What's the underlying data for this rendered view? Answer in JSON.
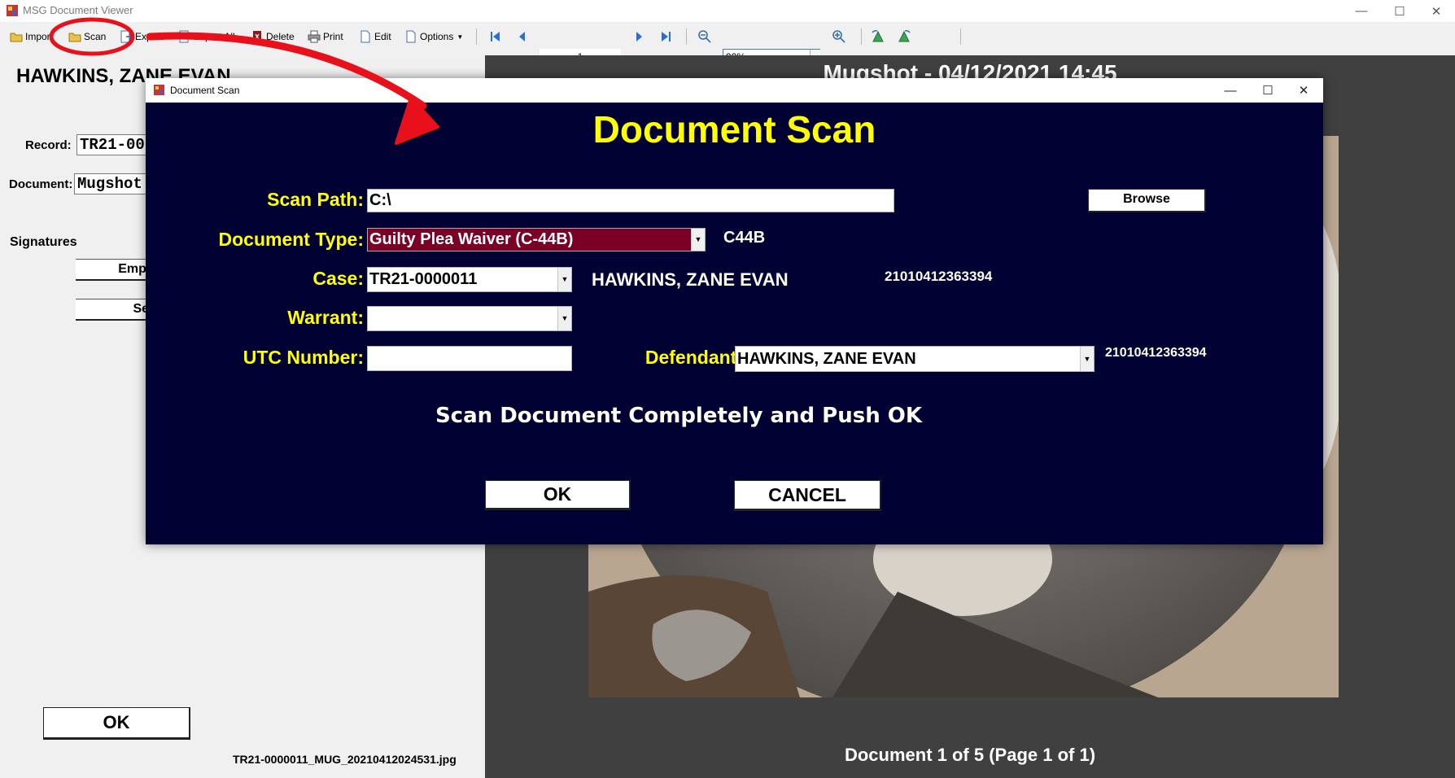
{
  "window": {
    "title": "MSG Document Viewer",
    "controls": {
      "minimize": "—",
      "maximize": "☐",
      "close": "✕"
    }
  },
  "toolbar": {
    "import_label": "Import",
    "scan_label": "Scan",
    "export_label": "Export",
    "export_all_label": "Export All",
    "delete_label": "Delete",
    "print_label": "Print",
    "edit_label": "Edit",
    "options_label": "Options",
    "page_value": "1",
    "zoom_value": "90%"
  },
  "left_panel": {
    "patient_name": "HAWKINS, ZANE EVAN",
    "record_label": "Record:",
    "record_value": "TR21-0000011",
    "document_label": "Document:",
    "document_value": "Mugshot",
    "signatures_label": "Signatures",
    "employee_button": "Employee",
    "send_button": "Send",
    "ok_button": "OK",
    "file_name": "TR21-0000011_MUG_20210412024531.jpg"
  },
  "viewer": {
    "title": "Mugshot - 04/12/2021 14:45",
    "doc_count": "Document 1 of 5 (Page 1 of 1)"
  },
  "dialog": {
    "title": "Document Scan",
    "heading": "Document Scan",
    "scan_path_label": "Scan Path:",
    "scan_path_value": "C:\\",
    "browse_button": "Browse",
    "doc_type_label": "Document Type:",
    "doc_type_value": "Guilty Plea Waiver (C-44B)",
    "doc_type_code": "C44B",
    "case_label": "Case:",
    "case_value": "TR21-0000011",
    "case_name": "HAWKINS, ZANE EVAN",
    "case_id": "21010412363394",
    "warrant_label": "Warrant:",
    "warrant_value": "",
    "utc_label": "UTC Number:",
    "utc_value": "",
    "defendant_label": "Defendant:",
    "defendant_value": "HAWKINS, ZANE EVAN",
    "defendant_id": "21010412363394",
    "instruction": "Scan Document Completely and Push OK",
    "ok_button": "OK",
    "cancel_button": "CANCEL"
  },
  "colors": {
    "dialog_bg": "#000033",
    "label_yellow": "#ffff00",
    "doc_type_highlight": "#7a0026",
    "annotation_red": "#e8101a",
    "viewer_bg": "#404040"
  }
}
